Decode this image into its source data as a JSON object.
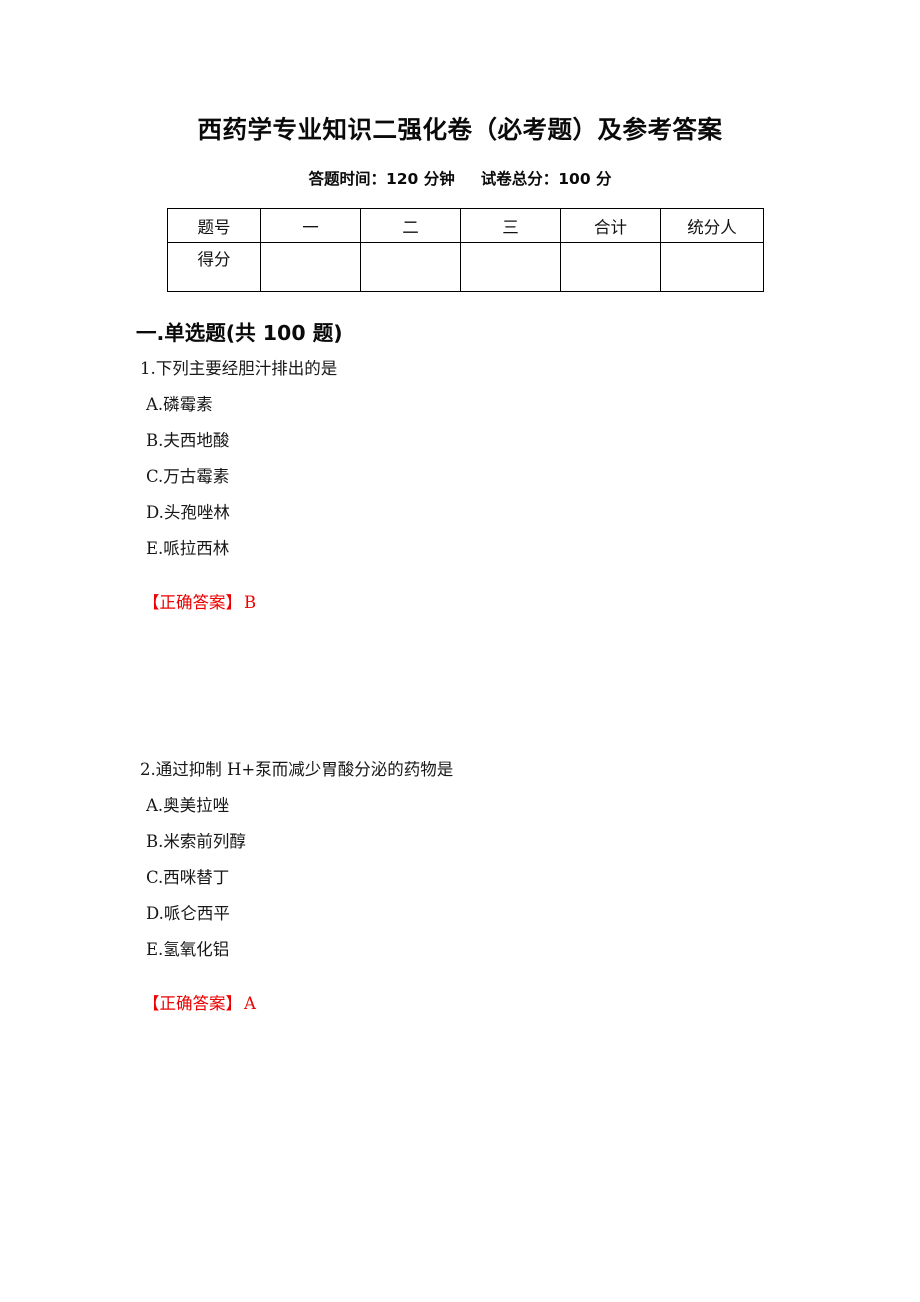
{
  "document": {
    "title": "西药学专业知识二强化卷（必考题）及参考答案",
    "subtitle": {
      "time_label": "答题时间：120 分钟",
      "total_label": "试卷总分：100 分"
    }
  },
  "score_table": {
    "headers": [
      "题号",
      "一",
      "二",
      "三",
      "合计",
      "统分人"
    ],
    "rows": [
      {
        "label": "得分",
        "cells": [
          "",
          "",
          "",
          "",
          ""
        ]
      }
    ]
  },
  "sections": [
    {
      "heading": "一.单选题(共 100 题)",
      "questions": [
        {
          "stem": "1.下列主要经胆汁排出的是",
          "options": [
            "A.磷霉素",
            "B.夫西地酸",
            "C.万古霉素",
            "D.头孢唑林",
            "E.哌拉西林"
          ],
          "answer_tag": "【正确答案】",
          "answer_value": "B"
        },
        {
          "stem": "2.通过抑制 H+泵而减少胃酸分泌的药物是",
          "options": [
            "A.奥美拉唑",
            "B.米索前列醇",
            "C.西咪替丁",
            "D.哌仑西平",
            "E.氢氧化铝"
          ],
          "answer_tag": "【正确答案】",
          "answer_value": "A"
        }
      ]
    }
  ],
  "colors": {
    "answer_red": "#ee0000",
    "text_black": "#171717",
    "table_outer_border": "#9e9ba8",
    "table_inner_border": "#000000",
    "page_background": "#ffffff"
  }
}
